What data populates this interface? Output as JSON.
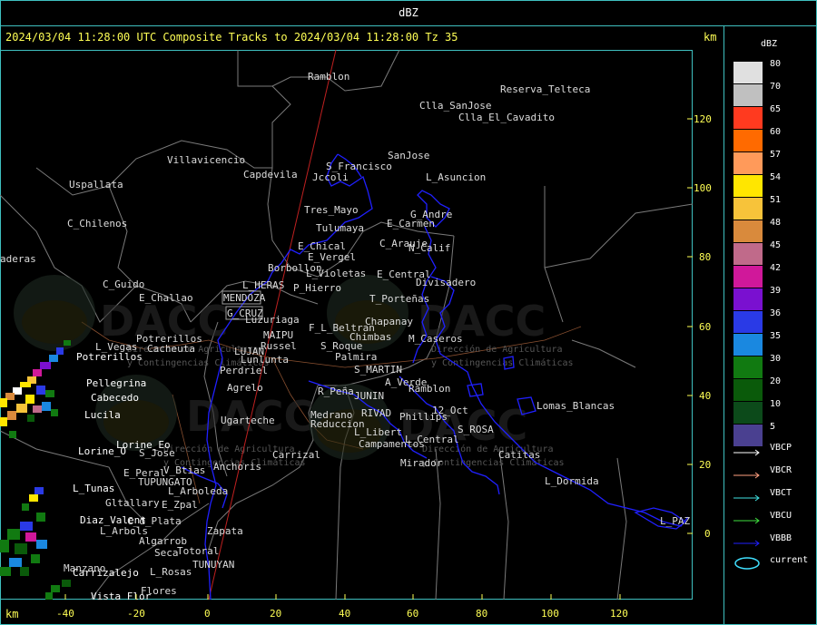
{
  "window": {
    "title": "dBZ"
  },
  "header": {
    "text": "2024/03/04 11:28:00 UTC Composite Tracks to 2024/03/04 11:28:00 Tz 35",
    "unit_top": "km",
    "unit_bottom": "km"
  },
  "axes": {
    "x_ticks": [
      "-40",
      "-20",
      "0",
      "20",
      "40",
      "60",
      "80",
      "100",
      "120"
    ],
    "y_ticks": [
      "120",
      "100",
      "80",
      "60",
      "40",
      "20",
      "0"
    ]
  },
  "legend": {
    "title": "dBZ",
    "scale": [
      {
        "label": "80",
        "color": "#e0e0e0"
      },
      {
        "label": "70",
        "color": "#c0c0c0"
      },
      {
        "label": "65",
        "color": "#ff3a1f"
      },
      {
        "label": "60",
        "color": "#ff6a00"
      },
      {
        "label": "57",
        "color": "#ff9a5a"
      },
      {
        "label": "54",
        "color": "#ffe600"
      },
      {
        "label": "51",
        "color": "#f7c33a"
      },
      {
        "label": "48",
        "color": "#d98a3c"
      },
      {
        "label": "45",
        "color": "#c06a8a"
      },
      {
        "label": "42",
        "color": "#d0189a"
      },
      {
        "label": "39",
        "color": "#7a10d0"
      },
      {
        "label": "36",
        "color": "#2a3ae6"
      },
      {
        "label": "35",
        "color": "#1a88e0"
      },
      {
        "label": "30",
        "color": "#117a11"
      },
      {
        "label": "20",
        "color": "#0a5a0a"
      },
      {
        "label": "10",
        "color": "#0c4a1a"
      },
      {
        "label": "5",
        "color": "#4a4090"
      }
    ],
    "tracks": [
      {
        "label": "VBCP",
        "color": "#ffffff"
      },
      {
        "label": "VBCR",
        "color": "#ffa080"
      },
      {
        "label": "VBCT",
        "color": "#40e0e0"
      },
      {
        "label": "VBCU",
        "color": "#40e040"
      },
      {
        "label": "VBBB",
        "color": "#2020ff"
      },
      {
        "label": "current",
        "color": "#40e0ff"
      }
    ]
  },
  "watermark": {
    "logo_text": "DACC",
    "org_line1": "Dirección de Agricultura",
    "org_line2": "y Contingencias Climáticas"
  },
  "places_white": [
    "Potrerillos",
    "Pellegrina",
    "Cabecedo",
    "Lucila",
    "Lorine_Eo",
    "Lorine_O",
    "L_Tunas",
    "Diaz_Valent",
    "Carrizalejo",
    "Vista_Flor"
  ],
  "places": [
    "Ramblon",
    "Reserva_Telteca",
    "Clla_SanJose",
    "Clla_El_Cavadito",
    "Villavicencio",
    "Capdevila",
    "S_Francisco",
    "Jccoli",
    "SanJose",
    "L_Asuncion",
    "Uspallata",
    "Tres_Mayo",
    "G_Andre",
    "E_Carmen",
    "C_Chilenos",
    "Tulumaya",
    "E_Chical",
    "C_Arauje",
    "N_Calif",
    "E_Vergel",
    "aderas",
    "Borbollon",
    "L_Violetas",
    "E_Central",
    "C_Guido",
    "L_HERAS",
    "P_Hierro",
    "Divisadero",
    "E_Challao",
    "MENDOZA",
    "T_Porteñas",
    "G_CRUZ",
    "Luzuriaga",
    "Chapanay",
    "F_L_Beltran",
    "MAIPU",
    "Chimbas",
    "M_Caseros",
    "L_Vegas",
    "Potrerillos",
    "Cacheuta",
    "LUJAN",
    "Russel",
    "S_Roque",
    "Lunlunta",
    "Palmira",
    "Perdriel",
    "S_MARTIN",
    "A_Verde",
    "Ramblon",
    "Agrelo",
    "R_Peña",
    "JUNIN",
    "Lomas_Blancas",
    "Ugarteche",
    "Medrano",
    "RIVAD",
    "12_Oct",
    "Phillips",
    "Reduccion",
    "S_ROSA",
    "L_Libert",
    "L_Central",
    "Campamentos",
    "Carrizal",
    "Catitas",
    "Mirador",
    "E_Peral",
    "V_Btias",
    "S_Jose",
    "Anchoris",
    "L_Dormida",
    "TUPUNGATO",
    "L_Arboleda",
    "Gltallary",
    "E_Zpal",
    "L_PAZ",
    "C_d_Plata",
    "L_Arbols",
    "Zapata",
    "Algarrob",
    "Seca",
    "Totoral",
    "Manzano",
    "L_Rosas",
    "TUNUYAN",
    "Flores"
  ]
}
